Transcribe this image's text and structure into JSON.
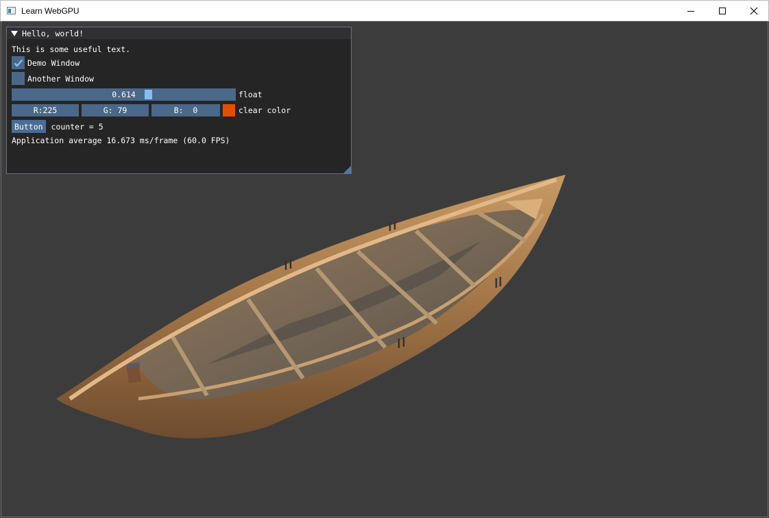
{
  "window": {
    "title": "Learn WebGPU",
    "controls": [
      "minimize",
      "maximize",
      "close"
    ]
  },
  "imgui": {
    "title": "Hello, world!",
    "text": "This is some useful text.",
    "checkboxes": [
      {
        "label": "Demo Window",
        "checked": true
      },
      {
        "label": "Another Window",
        "checked": false
      }
    ],
    "slider": {
      "value": "0.614",
      "fraction": 0.614,
      "label": "float"
    },
    "color": {
      "r": "R:225",
      "g": "G: 79",
      "b": "B:  0",
      "label": "clear color",
      "swatch": "#e14f00"
    },
    "button": {
      "label": "Button",
      "counter": "counter = 5"
    },
    "fps_text": "Application average 16.673 ms/frame (60.0 FPS)"
  },
  "colors": {
    "background": "#3c3c3c",
    "widget": "#4a6889",
    "accent": "#82bff2"
  }
}
